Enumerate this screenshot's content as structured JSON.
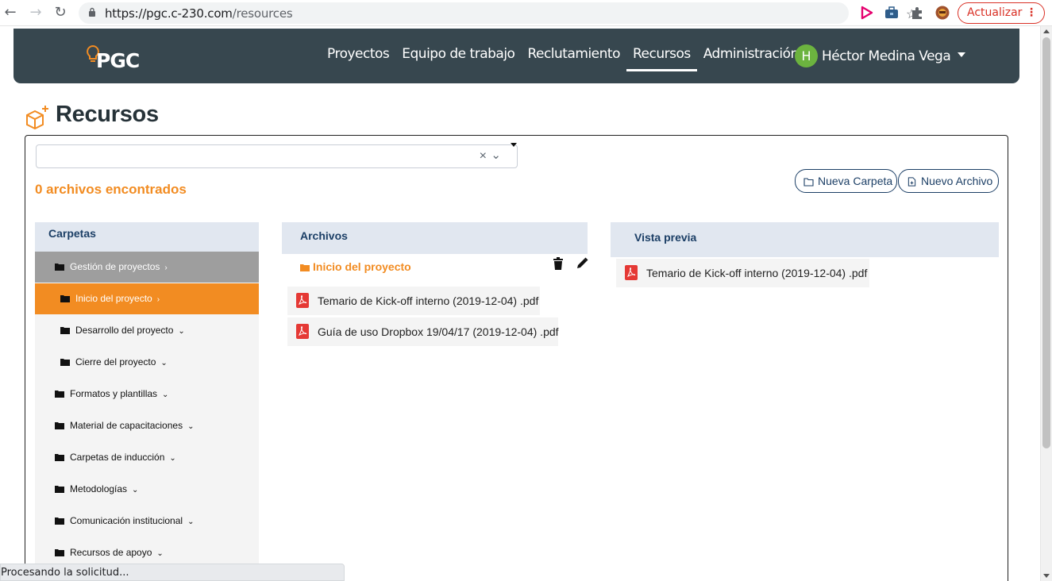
{
  "browser": {
    "url_host": "https://pgc.c-230.com",
    "url_path": "/resources",
    "update_label": "Actualizar",
    "menu_glyph": "⋮",
    "star_glyph": "☆"
  },
  "navbar": {
    "logo_text": "PGC",
    "links": [
      {
        "label": "Proyectos",
        "active": false
      },
      {
        "label": "Equipo de trabajo",
        "active": false
      },
      {
        "label": "Reclutamiento",
        "active": false
      },
      {
        "label": "Recursos",
        "active": true
      },
      {
        "label": "Administración",
        "active": false
      }
    ],
    "user_initial": "H",
    "user_name": "Héctor Medina Vega"
  },
  "page": {
    "title": "Recursos",
    "files_found": "0 archivos encontrados",
    "new_folder_label": "Nueva Carpeta",
    "new_file_label": "Nuevo Archivo"
  },
  "search": {
    "value": "",
    "clear_glyph": "×",
    "toggle_glyph": "⌄"
  },
  "folders": {
    "heading": "Carpetas",
    "items": [
      {
        "label": "Gestión de proyectos",
        "arrow": "›"
      },
      {
        "label": "Inicio del proyecto",
        "arrow": "›"
      },
      {
        "label": "Desarrollo del proyecto",
        "arrow": "⌄"
      },
      {
        "label": "Cierre del proyecto",
        "arrow": "⌄"
      },
      {
        "label": "Formatos y plantillas",
        "arrow": "⌄"
      },
      {
        "label": "Material de capacitaciones",
        "arrow": "⌄"
      },
      {
        "label": "Carpetas de inducción",
        "arrow": "⌄"
      },
      {
        "label": "Metodologías",
        "arrow": "⌄"
      },
      {
        "label": "Comunicación institucional",
        "arrow": "⌄"
      },
      {
        "label": "Recursos de apoyo",
        "arrow": "⌄"
      }
    ]
  },
  "files": {
    "heading": "Archivos",
    "current_folder": "Inicio del proyecto",
    "items": [
      {
        "name": "Temario de Kick-off interno (2019-12-04) .pdf"
      },
      {
        "name": "Guía de uso Dropbox 19/04/17 (2019-12-04) .pdf"
      }
    ]
  },
  "preview": {
    "heading": "Vista previa",
    "file_name": "Temario de Kick-off interno (2019-12-04) .pdf"
  },
  "status_bar": {
    "text": "Procesando la solicitud..."
  },
  "colors": {
    "navbar": "#37474f",
    "accent_orange": "#f28c22",
    "navy": "#1c3f66",
    "pdf_red": "#e53935",
    "avatar_green": "#6cb33f"
  }
}
